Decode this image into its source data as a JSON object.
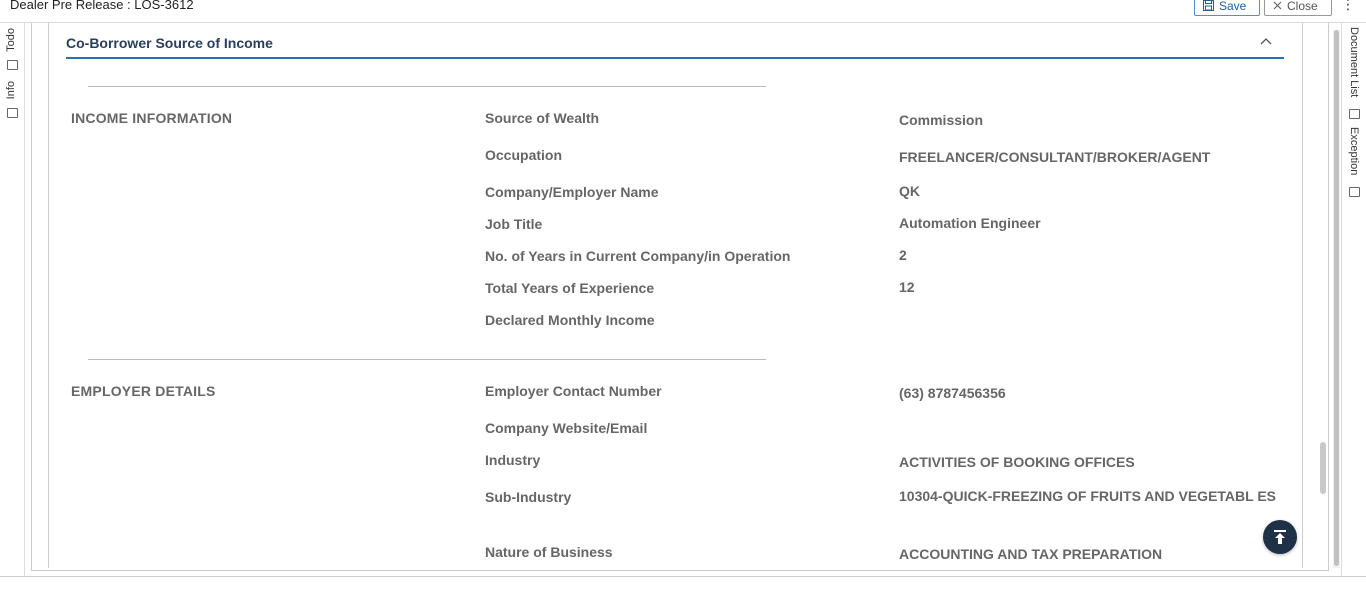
{
  "window": {
    "title": "Dealer Pre Release : LOS-3612"
  },
  "toolbar": {
    "save_label": "Save",
    "close_label": "Close"
  },
  "left_rail": {
    "tabs": [
      "Todo",
      "Info"
    ]
  },
  "right_rail": {
    "tabs": [
      "Document List",
      "Exception"
    ]
  },
  "section": {
    "title": "Co-Borrower Source of Income"
  },
  "income": {
    "heading": "INCOME INFORMATION",
    "fields": [
      {
        "label": "Source of Wealth",
        "value": "Commission"
      },
      {
        "label": "Occupation",
        "value": "FREELANCER/CONSULTANT/BROKER/AGENT"
      },
      {
        "label": "Company/Employer Name",
        "value": "QK"
      },
      {
        "label": "Job Title",
        "value": "Automation Engineer"
      },
      {
        "label": "No. of Years in Current Company/in Operation",
        "value": "2"
      },
      {
        "label": "Total Years of Experience",
        "value": "12"
      },
      {
        "label": "Declared Monthly Income",
        "value": ""
      }
    ]
  },
  "employer": {
    "heading": "EMPLOYER DETAILS",
    "fields": [
      {
        "label": "Employer Contact Number",
        "value": "(63) 8787456356"
      },
      {
        "label": "Company Website/Email",
        "value": ""
      },
      {
        "label": "Industry",
        "value": "ACTIVITIES OF BOOKING OFFICES"
      },
      {
        "label": "Sub-Industry",
        "value": "10304-QUICK-FREEZING OF FRUITS AND VEGETABL ES"
      },
      {
        "label": "Nature of Business",
        "value": "ACCOUNTING AND TAX PREPARATION"
      }
    ]
  },
  "colors": {
    "accent": "#2a6fb5",
    "fab": "#1f3147"
  },
  "icons": {
    "save": "save-icon",
    "close": "close-icon",
    "menu": "kebab-menu-icon",
    "collapse": "chevron-up-icon",
    "scroll_top": "scroll-to-top-icon"
  }
}
